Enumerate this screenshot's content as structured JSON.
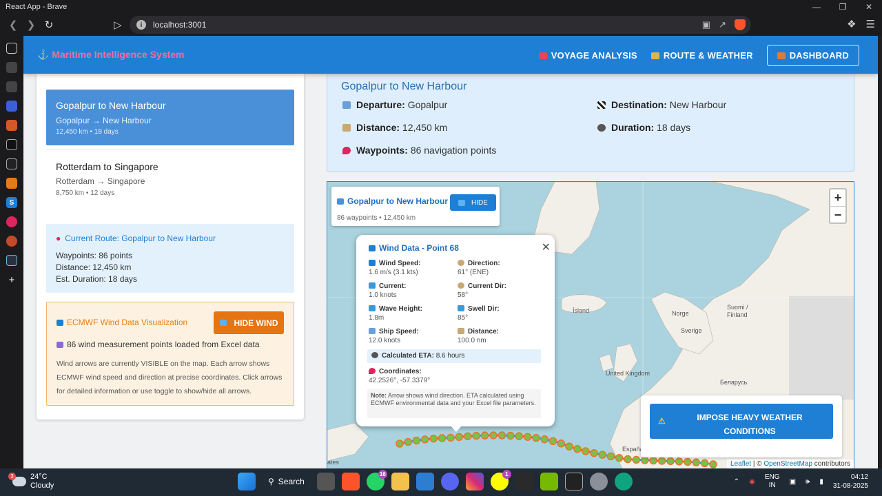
{
  "browser": {
    "window_title": "React App - Brave",
    "url": "localhost:3001",
    "controls": [
      "—",
      "❐",
      "✕"
    ]
  },
  "app": {
    "brand": "⚓ Maritime Intelligence System",
    "nav": [
      {
        "label": "VOYAGE ANALYSIS",
        "color": "#e04b4b"
      },
      {
        "label": "ROUTE & WEATHER",
        "color": "#e0b34b"
      },
      {
        "label": "DASHBOARD",
        "color": "#e07a3b"
      }
    ]
  },
  "routes": [
    {
      "title": "Gopalpur to New Harbour",
      "path": "Gopalpur → New Harbour",
      "meta": "12,450 km • 18 days"
    },
    {
      "title": "Rotterdam to Singapore",
      "path": "Rotterdam → Singapore",
      "meta": "8,750 km • 12 days"
    }
  ],
  "current_route": {
    "title": "Current Route: Gopalpur to New Harbour",
    "waypoints": "Waypoints: 86 points",
    "distance": "Distance: 12,450 km",
    "duration": "Est. Duration: 18 days"
  },
  "ecmwf": {
    "title": "ECMWF Wind Data Visualization",
    "button": "HIDE WIND",
    "count": "86 wind measurement points loaded from Excel data",
    "description": "Wind arrows are currently VISIBLE on the map. Each arrow shows ECMWF wind speed and direction at precise coordinates. Click arrows for detailed information or use toggle to show/hide all arrows."
  },
  "details": {
    "title": "Gopalpur to New Harbour",
    "departure_label": "Departure:",
    "departure": "Gopalpur",
    "destination_label": "Destination:",
    "destination": "New Harbour",
    "distance_label": "Distance:",
    "distance": "12,450 km",
    "duration_label": "Duration:",
    "duration": "18 days",
    "waypoints_label": "Waypoints:",
    "waypoints": "86 navigation points"
  },
  "map": {
    "route_title": "Gopalpur to New Harbour",
    "route_sub": "86 waypoints • 12,450 km",
    "hide_button": "HIDE",
    "labels": {
      "island": "Ísland",
      "norge": "Norge",
      "sverige": "Sverige",
      "suomi": "Suomi / Finland",
      "uk": "United Kingdom",
      "belarus": "Беларусь",
      "espana": "España",
      "ates": "ates"
    },
    "popup": {
      "title": "Wind Data - Point 68",
      "wind_speed_label": "Wind Speed:",
      "wind_speed": "1.6 m/s (3.1 kts)",
      "direction_label": "Direction:",
      "direction": "61° (ENE)",
      "current_label": "Current:",
      "current": "1.0 knots",
      "current_dir_label": "Current Dir:",
      "current_dir": "58°",
      "wave_label": "Wave Height:",
      "wave": "1.8m",
      "swell_label": "Swell Dir:",
      "swell": "85°",
      "ship_label": "Ship Speed:",
      "ship": "12.0 knots",
      "distance_label": "Distance:",
      "distance": "100.0 nm",
      "eta_label": "Calculated ETA:",
      "eta": "8.6 hours",
      "coords_label": "Coordinates:",
      "coords": "42.2526°, -57.3379°",
      "note_label": "Note:",
      "note": "Arrow shows wind direction. ETA calculated using ECMWF environmental data and your Excel file parameters."
    },
    "heavy_weather": "IMPOSE HEAVY WEATHER CONDITIONS",
    "attribution_leaflet": "Leaflet",
    "attribution_sep": "| ©",
    "attribution_osm": "OpenStreetMap",
    "attribution_tail": "contributors"
  },
  "taskbar": {
    "temp": "24°C",
    "condition": "Cloudy",
    "weather_badge": "3",
    "search": "Search",
    "whatsapp_badge": "16",
    "snap_badge": "1",
    "lang_top": "ENG",
    "lang_bottom": "IN",
    "time": "04:12",
    "date": "31-08-2025"
  }
}
